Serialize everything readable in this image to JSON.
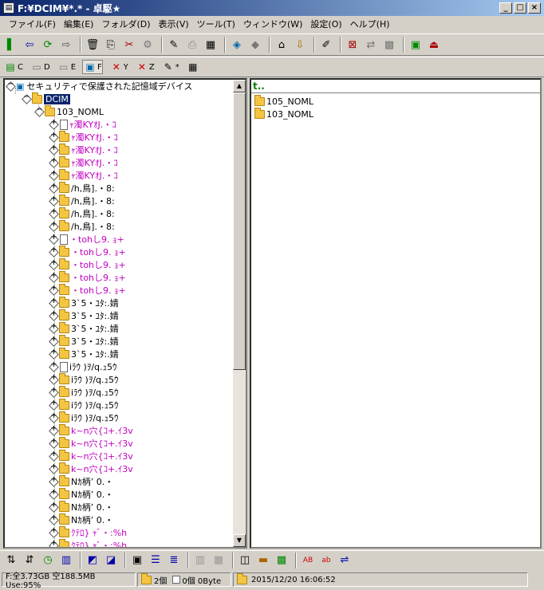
{
  "window": {
    "title": "F:¥DCIM¥*.* - 卓駆★",
    "min": "_",
    "max": "□",
    "close": "×"
  },
  "menu": [
    "ファイル(F)",
    "編集(E)",
    "フォルダ(D)",
    "表示(V)",
    "ツール(T)",
    "ウィンドウ(W)",
    "設定(O)",
    "ヘルプ(H)"
  ],
  "drives": [
    "C",
    "D",
    "E",
    "F",
    "Y",
    "Z",
    "*"
  ],
  "tree": {
    "root": "セキュリティで保護された記憶域デバイス",
    "dcim": "DCIM",
    "sub": "103_NOML",
    "items": [
      {
        "label": "ｬ濁KYｵJ.・ｺ",
        "file": true,
        "magenta": true
      },
      {
        "label": "ｬ濁KYｵJ.・ｺ",
        "magenta": true
      },
      {
        "label": "ｬ濁KYｵJ.・ｺ",
        "magenta": true
      },
      {
        "label": "ｬ濁KYｵJ.・ｺ",
        "magenta": true
      },
      {
        "label": "ｬ濁KYｵJ.・ｺ",
        "magenta": true
      },
      {
        "label": "/h,鳥].・8:"
      },
      {
        "label": "/h,鳥].・8:"
      },
      {
        "label": "/h,鳥].・8:"
      },
      {
        "label": "/h,鳥].・8:"
      },
      {
        "label": "・tohし9. ｮ+",
        "file": true,
        "magenta": true
      },
      {
        "label": "・tohし9. ｮ+",
        "magenta": true
      },
      {
        "label": "・tohし9. ｮ+",
        "magenta": true
      },
      {
        "label": "・tohし9. ｮ+",
        "magenta": true
      },
      {
        "label": "・tohし9. ｮ+",
        "magenta": true
      },
      {
        "label": "3`5・ﾕﾀ:.婧"
      },
      {
        "label": "3`5・ﾕﾀ:.婧"
      },
      {
        "label": "3`5・ﾕﾀ:.婧"
      },
      {
        "label": "3`5・ﾕﾀ:.婧"
      },
      {
        "label": "3`5・ﾕﾀ:.婧"
      },
      {
        "label": "iﾗｳ )ｦ/q.ｭ5ｳ",
        "file": true
      },
      {
        "label": "iﾗｳ )ｦ/q.ｭ5ｳ"
      },
      {
        "label": "iﾗｳ )ｦ/q.ｭ5ｳ"
      },
      {
        "label": "iﾗｳ )ｦ/q.ｭ5ｳ"
      },
      {
        "label": "iﾗｳ )ｦ/q.ｭ5ｳ"
      },
      {
        "label": "k~n穴{ｺ+.ｲ3v",
        "magenta": true
      },
      {
        "label": "k~n穴{ｺ+.ｲ3v",
        "magenta": true
      },
      {
        "label": "k~n穴{ｺ+.ｲ3v",
        "magenta": true
      },
      {
        "label": "k~n穴{ｺ+.ｲ3v",
        "magenta": true
      },
      {
        "label": "Nｶ柄’ 0.・"
      },
      {
        "label": "Nｶ柄’ 0.・"
      },
      {
        "label": "Nｶ柄’ 0.・"
      },
      {
        "label": "Nｶ柄’ 0.・"
      },
      {
        "label": "ｸﾃﾛ} ｬﾞ・:%h",
        "magenta": true
      },
      {
        "label": "ｸﾃﾛ} ｬﾞ・:%h",
        "magenta": true
      }
    ]
  },
  "list": {
    "up": "t..",
    "items": [
      "105_NOML",
      "103_NOML"
    ]
  },
  "status": {
    "disk": "F:全3.73GB 空188.5MB Use:95%",
    "dirs": "2個",
    "files": "0個 0Byte",
    "date": "2015/12/20 16:06:52"
  }
}
